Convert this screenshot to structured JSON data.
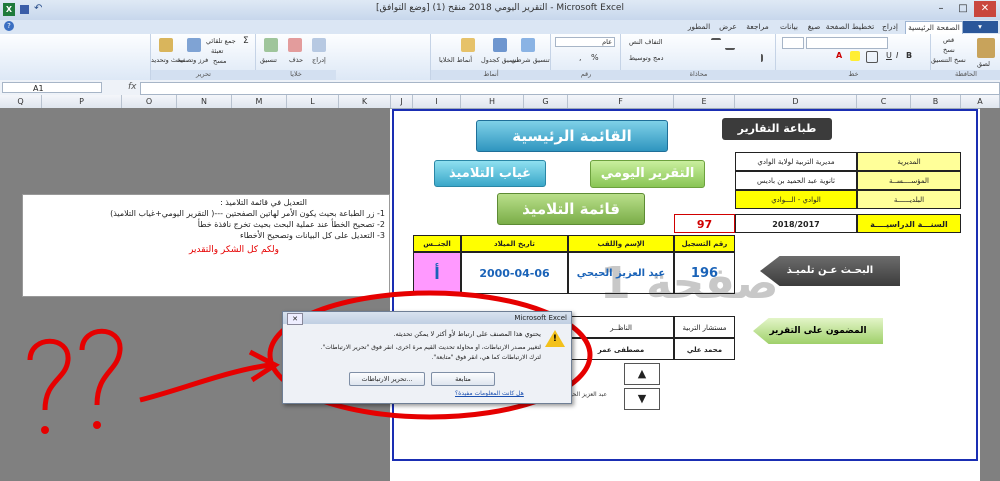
{
  "window": {
    "title": "التقرير اليومي 2018 منقح (1) [وضع التوافق] - Microsoft Excel",
    "minimize": "–",
    "maximize": "□",
    "close": "✕"
  },
  "ribbon": {
    "tabs": [
      "الصفحة الرئيسية",
      "إدراج",
      "تخطيط الصفحة",
      "صيغ",
      "بيانات",
      "مراجعة",
      "عرض",
      "المطور"
    ],
    "active_tab": "الصفحة الرئيسية",
    "groups": {
      "clipboard": {
        "label": "الحافظة",
        "paste": "لصق",
        "cut": "قص",
        "copy": "نسخ",
        "format_painter": "نسخ التنسيق"
      },
      "font": {
        "label": "خط"
      },
      "alignment": {
        "label": "محاذاة",
        "wrap": "التفاف النص",
        "merge": "دمج وتوسيط"
      },
      "number": {
        "label": "رقم",
        "format": "عام"
      },
      "styles": {
        "label": "أنماط",
        "conditional": "تنسيق شرطي",
        "as_table": "تنسيق كجدول",
        "cell_styles": "أنماط الخلايا"
      },
      "cells": {
        "label": "خلايا",
        "insert": "إدراج",
        "delete": "حذف",
        "format": "تنسيق"
      },
      "editing": {
        "label": "تحرير",
        "autosum": "جمع تلقائي",
        "fill": "تعبئة",
        "clear": "مسح",
        "sort": "فرز وتصفية",
        "find": "بحث وتحديد"
      }
    }
  },
  "formula_bar": {
    "name_box": "A1",
    "fx": "fx",
    "formula": ""
  },
  "columns": [
    "Q",
    "P",
    "O",
    "N",
    "M",
    "L",
    "K",
    "J",
    "I",
    "H",
    "G",
    "F",
    "E",
    "D",
    "C",
    "B",
    "A"
  ],
  "shapes": {
    "print_reports": "طباعة التقارير",
    "main_menu": "القائمة الرئيسية",
    "daily_report": "التقرير اليومي",
    "student_absence": "غياب التلاميذ",
    "student_list": "قائمة التلاميذ",
    "search_student": "البحـث عـن تلميـذ",
    "report_content": "المضمون على التقرير",
    "watermark": "صفحة 1"
  },
  "info_table": [
    {
      "label": "المديرية",
      "value": "مديرية التربية لولاية الوادي"
    },
    {
      "label": "المؤســــســة",
      "value": "ثانوية عبد الحميد بن باديس"
    },
    {
      "label": "البلديــــــة",
      "value": "الوادي - الـــوادي"
    },
    {
      "label": "السنـــة الدراسيــــة",
      "value": "2018/2017"
    }
  ],
  "record_number": "97",
  "student_table": {
    "headers": [
      "رقم التسجيل",
      "الإسم واللقب",
      "تاريخ الميلاد",
      "الجنــس"
    ],
    "row": {
      "reg": "196",
      "name": "عبد العزيز الحيحي",
      "dob": "2000-04-06",
      "gender": "أ"
    }
  },
  "signatures": {
    "headers": [
      "مستشار التربية",
      "الناظــر"
    ],
    "values": [
      "محمد علي",
      "مصطفى عمر"
    ],
    "partial": "عبد العزيز الحيحي"
  },
  "nav": {
    "up": "▲",
    "down": "▼"
  },
  "note": {
    "lines": [
      "التعديل في  قائمة التلاميذ :",
      "1- زر الطباعة بحيث يكون الأمر لهاتين الصفحتين ---( التقرير اليومي+غياب التلاميذ)",
      "2- تصحيح الخطأ عند عملية البحث بحيث تخرج نافذة خطأ",
      "3- التعديل على كل البيانات وتصحيح الأخطاء"
    ],
    "thanks": "ولكم كل الشكر والتقدير"
  },
  "dialog": {
    "title": "Microsoft Excel",
    "message": "يحتوي هذا المصنف على ارتباط لأو أكثر لا يمكن تحديثه.",
    "bullet1": "لتغيير مصدر الارتباطات، أو محاولة تحديث القيم مرة أخرى، انقر فوق \"تحرير الارتباطات\".",
    "bullet2": "لترك الارتباطات كما هي، انقر فوق \"متابعة\".",
    "continue": "متابعة",
    "edit_links": "تحرير الارتباطات...",
    "help": "هل كانت المعلومات مفيدة؟",
    "close": "✕"
  },
  "annotation": {
    "text": "؟؟"
  },
  "colors": {
    "sheet_border": "#1a2eb3",
    "teal_button": "#3aa7c9",
    "green_button": "#a9d86e",
    "header_yellow": "#ffff00",
    "pink_cell": "#ff99ff",
    "red_marker": "#e60000"
  }
}
